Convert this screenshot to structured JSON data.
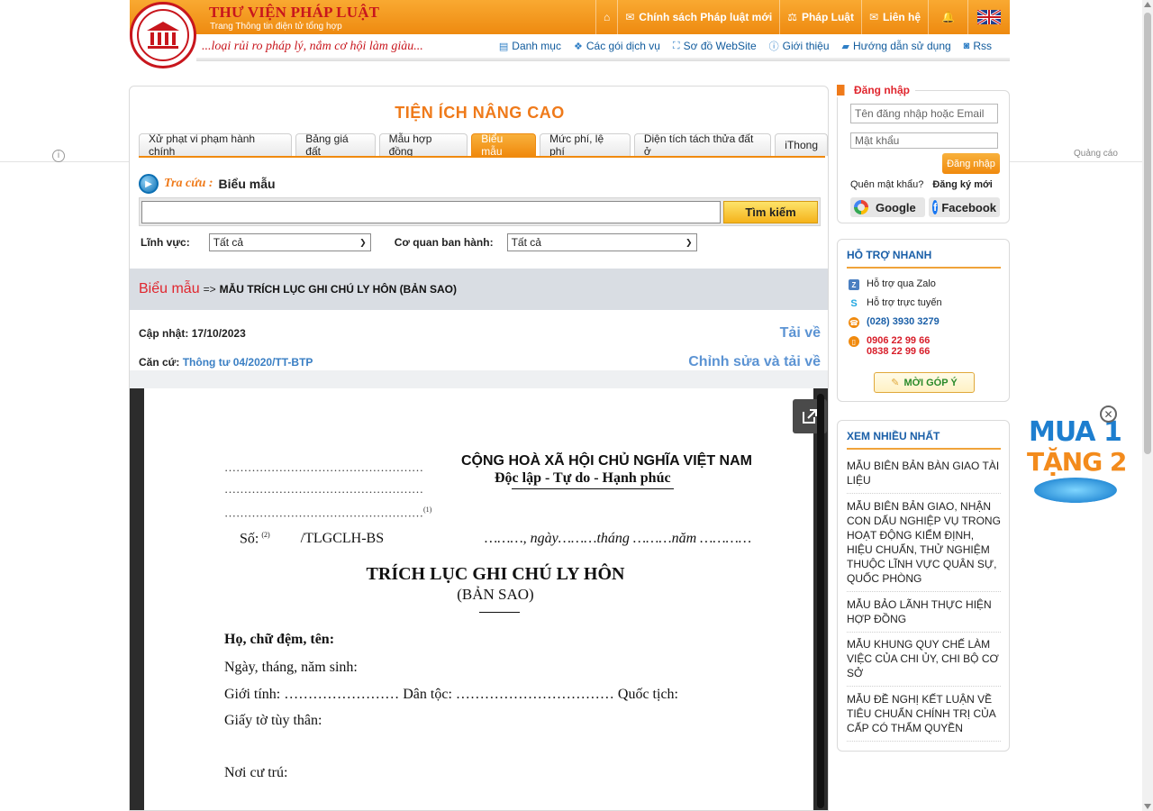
{
  "brand": {
    "title": "THƯ VIỆN PHÁP LUẬT",
    "subtitle": "Trang Thông tin điện tử tổng hợp",
    "slogan": "...loại rủi ro pháp lý, nắm cơ hội làm giàu..."
  },
  "topnav": [
    {
      "label": "",
      "icon": "home-icon"
    },
    {
      "label": "Chính sách Pháp luật mới",
      "icon": "mail-icon"
    },
    {
      "label": "Pháp Luật",
      "icon": "gavel-icon"
    },
    {
      "label": "Liên hệ",
      "icon": "envelope-icon"
    }
  ],
  "subnav": [
    {
      "label": "Danh mục",
      "icon": "list-icon"
    },
    {
      "label": "Các gói dịch vụ",
      "icon": "box-icon"
    },
    {
      "label": "Sơ đồ WebSite",
      "icon": "sitemap-icon"
    },
    {
      "label": "Giới thiệu",
      "icon": "info-icon"
    },
    {
      "label": "Hướng dẫn sử dụng",
      "icon": "book-icon"
    },
    {
      "label": "Rss",
      "icon": "rss-icon"
    }
  ],
  "ad_label": "Quảng cáo",
  "main": {
    "title": "TIỆN ÍCH NÂNG CAO",
    "tabs": [
      {
        "label": "Xử phạt vi phạm hành chính"
      },
      {
        "label": "Bảng giá đất"
      },
      {
        "label": "Mẫu hợp đồng"
      },
      {
        "label": "Biểu mẫu",
        "active": true
      },
      {
        "label": "Mức phí, lệ phí"
      },
      {
        "label": "Diện tích tách thửa đất ở"
      },
      {
        "label": "iThong"
      }
    ],
    "search": {
      "lookup_label": "Tra cứu :",
      "lookup_value": "Biểu mẫu",
      "input_value": "",
      "button_label": "Tìm kiếm",
      "field_label": "Lĩnh vực:",
      "field_value": "Tất cả",
      "agency_label": "Cơ quan ban hành:",
      "agency_value": "Tất cả"
    },
    "breadcrumb": {
      "section": "Biểu mẫu",
      "sep": "=>",
      "current": "MẪU TRÍCH LỤC GHI CHÚ LY HÔN (BẢN SAO)"
    },
    "meta": {
      "updated_label": "Cập nhật:",
      "updated_value": "17/10/2023",
      "basis_label": "Căn cứ:",
      "basis_value": "Thông tư 04/2020/TT-BTP",
      "download": "Tải về",
      "edit_download": "Chỉnh sửa và tải về"
    }
  },
  "document": {
    "dots1": "……………………………………………",
    "dots2": "……………………………………………",
    "dots3": "……………………………………………",
    "dots3_sup": "(1)",
    "country": "CỘNG HOÀ XÃ HỘI CHỦ NGHĨA VIỆT NAM",
    "motto": "Độc lập - Tự do - Hạnh phúc",
    "so_label": "Số:",
    "so_sup": "(2)",
    "so_code": "/TLGCLH-BS",
    "date_line": "………, ngày………tháng ………năm …………",
    "title": "TRÍCH LỤC GHI CHÚ LY HÔN",
    "subtitle": "(BẢN SAO)",
    "fields": [
      "Họ, chữ đệm, tên:",
      "Ngày, tháng, năm sinh:",
      "Giới tính: …………………… Dân tộc: …………………………… Quốc tịch:",
      "Giấy tờ tùy thân:",
      "Nơi cư trú:"
    ]
  },
  "login": {
    "legend": "Đăng nhập",
    "username_placeholder": "Tên đăng nhập hoặc Email",
    "password_placeholder": "Mật khẩu",
    "button": "Đăng nhập",
    "forgot": "Quên mật khẩu?",
    "register": "Đăng ký mới",
    "google": "Google",
    "facebook": "Facebook"
  },
  "support": {
    "title": "HỖ TRỢ NHANH",
    "zalo": "Hỗ trợ qua Zalo",
    "online": "Hỗ trợ trực tuyến",
    "phone1": "(028) 3930 3279",
    "phone2": "0906 22 99 66",
    "phone3": "0838 22 99 66",
    "feedback": "MỜI GÓP Ý"
  },
  "popular": {
    "title": "XEM NHIỀU NHẤT",
    "items": [
      "MẪU BIÊN BẢN BÀN GIAO TÀI LIỆU",
      "MẪU BIÊN BẢN GIAO, NHẬN CON DẤU NGHIỆP VỤ TRONG HOẠT ĐỘNG KIỂM ĐỊNH, HIỆU CHUẨN, THỬ NGHIỆM THUỘC LĨNH VỰC QUÂN SỰ, QUỐC PHÒNG",
      "MẪU BẢO LÃNH THỰC HIỆN HỢP ĐỒNG",
      "MẪU KHUNG QUY CHẾ LÀM VIỆC CỦA CHI ỦY, CHI BỘ CƠ SỞ",
      "MẪU ĐỀ NGHỊ KẾT LUẬN VỀ TIÊU CHUẨN CHÍNH TRỊ CỦA CẤP CÓ THẨM QUYỀN"
    ]
  },
  "promo": {
    "line1": "MUA 1",
    "line2": "TẶNG 2"
  },
  "colors": {
    "orange": "#f08a0e",
    "brand_red": "#c8161d",
    "link_blue": "#1a5fa8"
  }
}
